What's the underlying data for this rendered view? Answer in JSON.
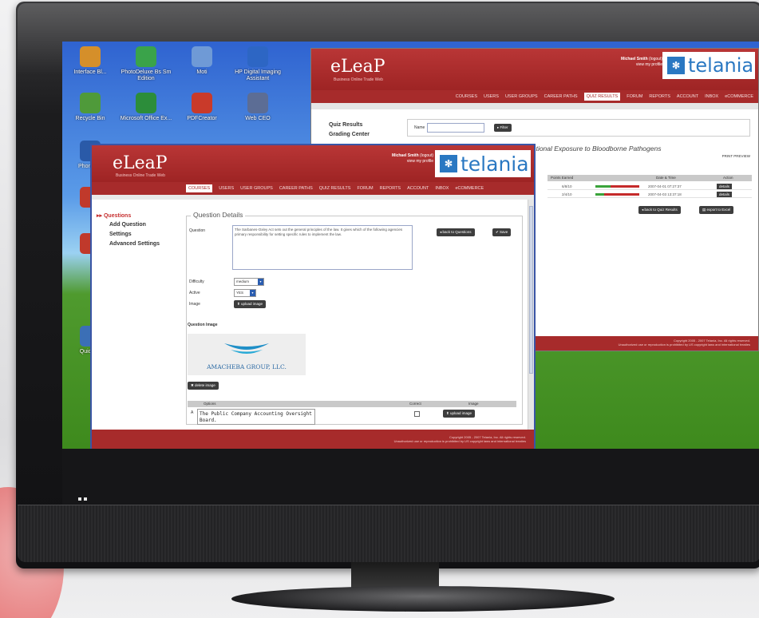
{
  "desktop": {
    "icons": [
      {
        "label": "Interface Bl...",
        "color": "#d58f2a"
      },
      {
        "label": "PhotoDeluxe Bs Sm Edition",
        "color": "#3aa34a"
      },
      {
        "label": "Moti",
        "color": "#6f9ad6"
      },
      {
        "label": "HP Digital Imaging Assistant",
        "color": "#2d66c4"
      },
      {
        "label": "Recycle Bin",
        "color": "#4f9a3a"
      },
      {
        "label": "Microsoft Office Ex...",
        "color": "#2c8d3a"
      },
      {
        "label": "PDFCreator",
        "color": "#c93a2a"
      },
      {
        "label": "Web CEO",
        "color": "#5c6d95"
      },
      {
        "label": "Phon Wiz",
        "color": "#2a5aa8"
      },
      {
        "label": "",
        "color": "#c0392b"
      },
      {
        "label": "",
        "color": "#c0392b"
      },
      {
        "label": "Quic Pla",
        "color": "#3b6fb6"
      }
    ]
  },
  "back_window": {
    "logo": "eLeaP",
    "tagline": "Business Online Trade Web",
    "user_name": "Michael Smith",
    "user_logout": "(logout)",
    "user_profile": "view my profile",
    "brand": "telania",
    "nav": [
      "COURSES",
      "USERS",
      "USER GROUPS",
      "CAREER PATHS",
      "QUIZ RESULTS",
      "FORUM",
      "REPORTS",
      "ACCOUNT",
      "INBOX",
      "eCOMMERCE"
    ],
    "nav_active": "QUIZ RESULTS",
    "sidebar": [
      "Quiz Results",
      "Grading Center"
    ],
    "filter_label": "Name",
    "filter_button": "Filter",
    "title": "Procedures for the Occupational Exposure to Bloodborne Pathogens",
    "print_label": "PRINT PREVIEW",
    "table_headers": [
      "Points Earned",
      "Date & Time",
      "Action"
    ],
    "rows": [
      {
        "points": "6/8/10",
        "score": 0.35,
        "date": "2007-04-01 07:27:37",
        "action": "details"
      },
      {
        "points": "2/4/10",
        "score": 0.2,
        "date": "2007-04-03 13:37:18",
        "action": "details"
      }
    ],
    "back_button": "back to Quiz Results",
    "export_button": "export to Excel",
    "footer_line1": "Copyright 2005 - 2007 Telania, Inc. All rights reserved.",
    "footer_line2": "Unauthorized use or reproduction is prohibited by US copyright laws and international treaties"
  },
  "front_window": {
    "logo": "eLeaP",
    "tagline": "Business Online Trade Web",
    "user_name": "Michael Smith",
    "user_logout": "(logout)",
    "user_profile": "view my profile",
    "brand": "telania",
    "nav": [
      "COURSES",
      "USERS",
      "USER GROUPS",
      "CAREER PATHS",
      "QUIZ RESULTS",
      "FORUM",
      "REPORTS",
      "ACCOUNT",
      "INBOX",
      "eCOMMERCE"
    ],
    "nav_active": "COURSES",
    "sidebar": [
      {
        "label": "Questions",
        "active": true
      },
      {
        "label": "Add Question",
        "active": false
      },
      {
        "label": "Settings",
        "active": false
      },
      {
        "label": "Advanced Settings",
        "active": false
      }
    ],
    "legend": "Question Details",
    "question_label": "Question",
    "question_text": "The Sarbanes-Oxley Act sets out the general principles of the law. It gives which of the following agencies primary responsibility for setting specific rules to implement the law.",
    "back_questions_button": "back to Questions",
    "save_button": "Save",
    "difficulty_label": "Difficulty",
    "difficulty_value": "medium",
    "active_label": "Active",
    "active_value": "YES",
    "image_label": "Image",
    "upload_button": "upload image",
    "question_image_label": "Question Image",
    "company_name": "AMACHEBA GROUP, LLC.",
    "delete_image_button": "delete image",
    "options_headers": [
      "Options",
      "Correct",
      "Image"
    ],
    "option_marker": "A",
    "option_text": "The Public Company Accounting Oversight Board.",
    "option_upload": "upload image",
    "footer_line1": "Copyright 2005 - 2007 Telania, Inc. All rights reserved.",
    "footer_line2": "Unauthorized use or reproduction is prohibited by US copyright laws and international treaties"
  },
  "colors": {
    "brand_red": "#a72b2b",
    "brand_blue": "#2a78c2",
    "active_red": "#c62f2f"
  }
}
